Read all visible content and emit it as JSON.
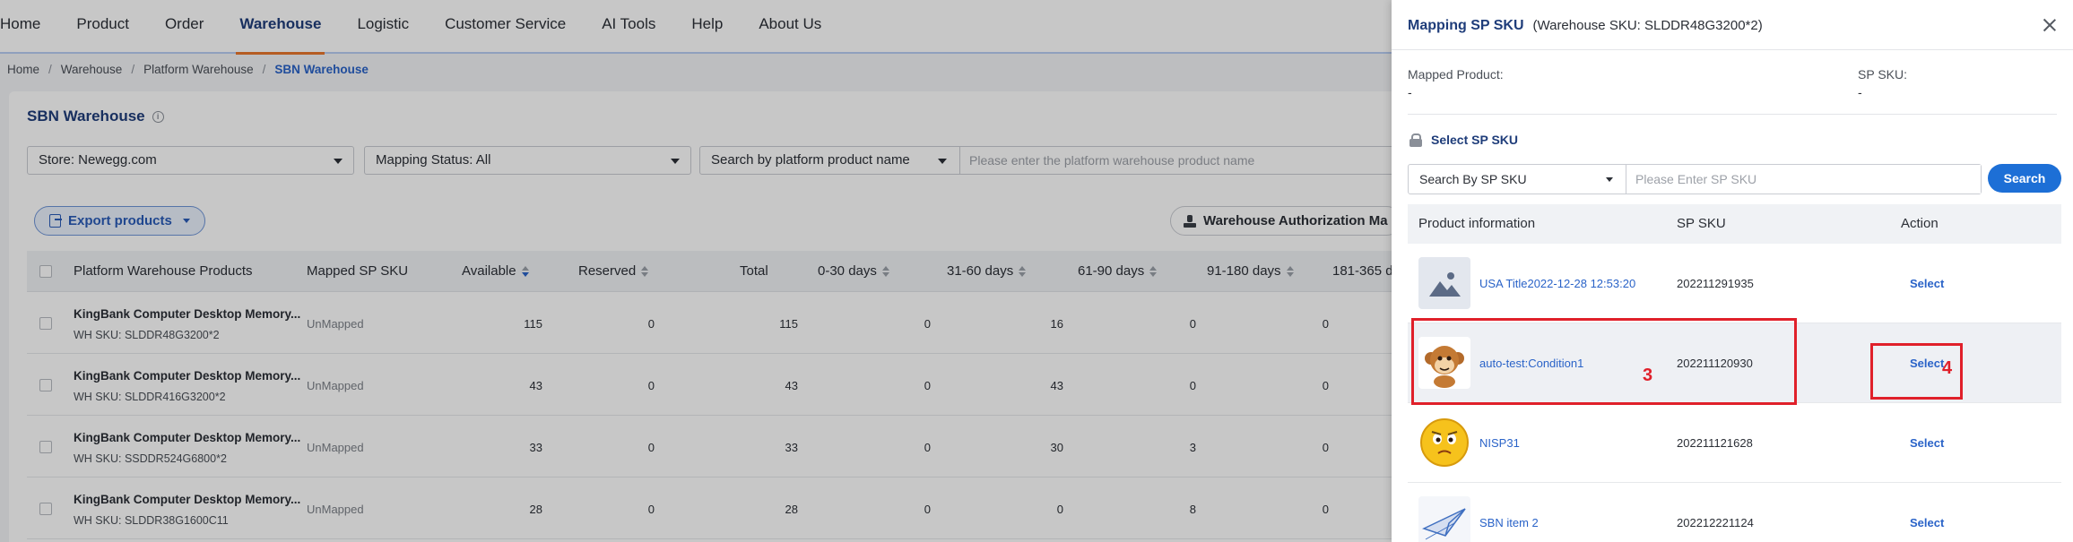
{
  "nav": {
    "items": [
      "Home",
      "Product",
      "Order",
      "Warehouse",
      "Logistic",
      "Customer Service",
      "AI Tools",
      "Help",
      "About Us"
    ],
    "active": "Warehouse"
  },
  "breadcrumb": [
    "Home",
    "Warehouse",
    "Platform Warehouse",
    "SBN Warehouse"
  ],
  "page": {
    "title": "SBN Warehouse",
    "store_filter": "Store: Newegg.com",
    "mapping_filter": "Mapping Status: All",
    "search_by": "Search by platform product name",
    "search_placeholder": "Please enter the platform warehouse product name",
    "export_label": "Export products",
    "auth_label": "Warehouse Authorization Ma"
  },
  "table": {
    "columns": [
      "Platform Warehouse Products",
      "Mapped SP SKU",
      "Available",
      "Reserved",
      "Total",
      "0-30 days",
      "31-60 days",
      "61-90 days",
      "91-180 days",
      "181-365 d"
    ],
    "rows": [
      {
        "name": "KingBank Computer Desktop Memory...",
        "sku": "WH SKU: SLDDR48G3200*2",
        "mapped": "UnMapped",
        "available": "115",
        "reserved": "0",
        "total": "115",
        "d0_30": "0",
        "d31_60": "16",
        "d61_90": "0",
        "d91_180": "0"
      },
      {
        "name": "KingBank Computer Desktop Memory...",
        "sku": "WH SKU: SLDDR416G3200*2",
        "mapped": "UnMapped",
        "available": "43",
        "reserved": "0",
        "total": "43",
        "d0_30": "0",
        "d31_60": "43",
        "d61_90": "0",
        "d91_180": "0"
      },
      {
        "name": "KingBank Computer Desktop Memory...",
        "sku": "WH SKU: SSDDR524G6800*2",
        "mapped": "UnMapped",
        "available": "33",
        "reserved": "0",
        "total": "33",
        "d0_30": "0",
        "d31_60": "30",
        "d61_90": "3",
        "d91_180": "0"
      },
      {
        "name": "KingBank Computer Desktop Memory...",
        "sku": "WH SKU: SLDDR38G1600C11",
        "mapped": "UnMapped",
        "available": "28",
        "reserved": "0",
        "total": "28",
        "d0_30": "0",
        "d31_60": "0",
        "d61_90": "8",
        "d91_180": "0"
      }
    ]
  },
  "drawer": {
    "title": "Mapping SP SKU",
    "subtitle": "(Warehouse SKU: SLDDR48G3200*2)",
    "mapped_product_label": "Mapped Product:",
    "mapped_product_value": "-",
    "sp_sku_label": "SP SKU:",
    "sp_sku_value": "-",
    "select_label": "Select SP SKU",
    "search_by": "Search By SP SKU",
    "search_placeholder": "Please Enter SP SKU",
    "search_button": "Search",
    "columns": [
      "Product information",
      "SP SKU",
      "Action"
    ],
    "rows": [
      {
        "name": "USA Title2022-12-28 12:53:20",
        "sku": "202211291935",
        "action": "Select",
        "thumb": "placeholder-image-icon"
      },
      {
        "name": "auto-test:Condition1",
        "sku": "202211120930",
        "action": "Select",
        "thumb": "monkey-image"
      },
      {
        "name": "NISP31",
        "sku": "202211121628",
        "action": "Select",
        "thumb": "emoji-face-image"
      },
      {
        "name": "SBN item 2",
        "sku": "202212221124",
        "action": "Select",
        "thumb": "paper-plane-image"
      }
    ]
  },
  "annotations": [
    "3",
    "4"
  ],
  "colors": {
    "accent": "#1d6fd6",
    "nav_active_underline": "#e8772e",
    "annotation": "#e0202a",
    "title": "#1f3d7a"
  }
}
